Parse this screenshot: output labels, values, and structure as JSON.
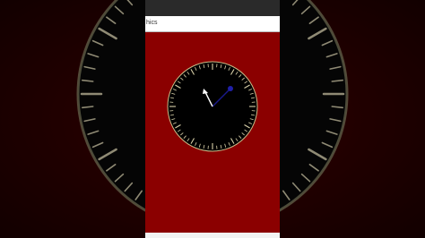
{
  "app_bar": {
    "title": "hics"
  },
  "colors": {
    "content_background": "#8b0000",
    "dial_face": "#000000",
    "dial_rim": "#d8c890",
    "tick_color": "#d8d0a8",
    "hand_white": "#ffffff",
    "hand_blue": "#2020a0",
    "backdrop": "#1e0000"
  },
  "icons": [
    "analog-clock-icon"
  ]
}
